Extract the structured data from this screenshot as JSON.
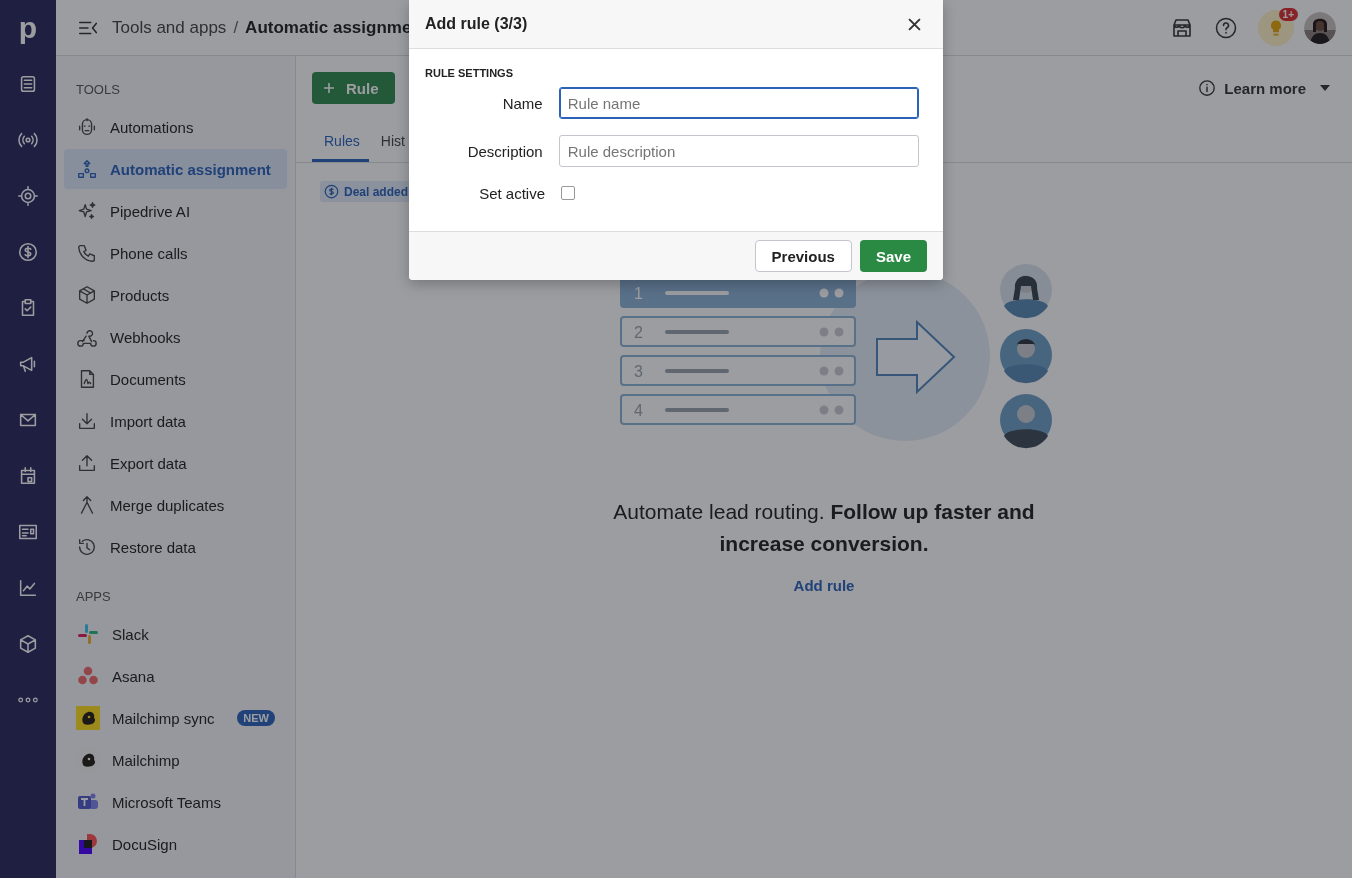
{
  "rail": {
    "logo": "p"
  },
  "header": {
    "breadcrumb_parent": "Tools and apps",
    "separator": "/",
    "breadcrumb_current": "Automatic assignme",
    "notification_badge": "1+"
  },
  "sidebar": {
    "sections": [
      {
        "title": "TOOLS",
        "items": [
          {
            "label": "Automations",
            "selected": false
          },
          {
            "label": "Automatic assignment",
            "selected": true
          },
          {
            "label": "Pipedrive AI",
            "selected": false
          },
          {
            "label": "Phone calls",
            "selected": false
          },
          {
            "label": "Products",
            "selected": false
          },
          {
            "label": "Webhooks",
            "selected": false
          },
          {
            "label": "Documents",
            "selected": false
          },
          {
            "label": "Import data",
            "selected": false
          },
          {
            "label": "Export data",
            "selected": false
          },
          {
            "label": "Merge duplicates",
            "selected": false
          },
          {
            "label": "Restore data",
            "selected": false
          }
        ]
      },
      {
        "title": "APPS",
        "items": [
          {
            "label": "Slack",
            "selected": false
          },
          {
            "label": "Asana",
            "selected": false
          },
          {
            "label": "Mailchimp sync",
            "selected": false,
            "badge": "NEW"
          },
          {
            "label": "Mailchimp",
            "selected": false
          },
          {
            "label": "Microsoft Teams",
            "selected": false
          },
          {
            "label": "DocuSign",
            "selected": false
          }
        ]
      }
    ]
  },
  "main": {
    "add_button": "Rule",
    "learn_more": "Learn more",
    "tabs": [
      {
        "label": "Rules",
        "selected": true
      },
      {
        "label": "Hist",
        "selected": false
      }
    ],
    "filter_chip": "Deal added",
    "illustration_rows": [
      {
        "label": "1",
        "selected": true
      },
      {
        "label": "2",
        "selected": false
      },
      {
        "label": "3",
        "selected": false
      },
      {
        "label": "4",
        "selected": false
      }
    ],
    "headline": "Automate lead routing. **Follow up faster and increase conversion.**",
    "link": "Add rule"
  },
  "modal": {
    "title": "Add rule (3/3)",
    "section": "RULE SETTINGS",
    "fields": [
      {
        "kind": "text",
        "label": "Name",
        "placeholder": "Rule name",
        "focused": true
      },
      {
        "kind": "text",
        "label": "Description",
        "placeholder": "Rule description",
        "focused": false
      },
      {
        "kind": "checkbox",
        "label": "Set active",
        "checked": false
      }
    ],
    "secondary_button": "Previous",
    "primary_button": "Save"
  }
}
